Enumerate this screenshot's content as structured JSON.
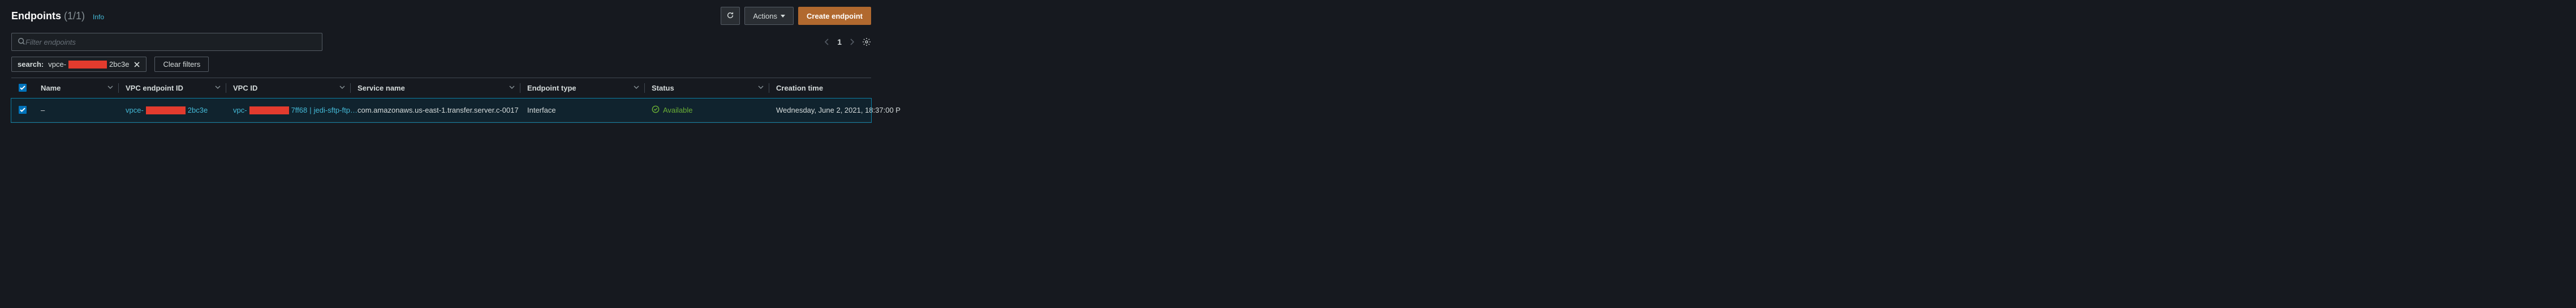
{
  "header": {
    "title": "Endpoints",
    "count": "(1/1)",
    "info": "Info"
  },
  "buttons": {
    "refresh": "",
    "actions": "Actions",
    "create": "Create endpoint",
    "clear_filters": "Clear filters"
  },
  "search": {
    "placeholder": "Filter endpoints"
  },
  "chip": {
    "prefix": "search:",
    "value_pre": "vpce-",
    "value_post": "2bc3e"
  },
  "pager": {
    "page": "1"
  },
  "columns": {
    "name": "Name",
    "endpoint_id": "VPC endpoint ID",
    "vpc_id": "VPC ID",
    "service": "Service name",
    "type": "Endpoint type",
    "status": "Status",
    "created": "Creation time"
  },
  "row": {
    "name": "–",
    "endpoint_pre": "vpce-",
    "endpoint_post": "2bc3e",
    "vpc_pre": "vpc-",
    "vpc_post": "7ff68",
    "vpc_sep": " | ",
    "vpc_name": "jedi-sftp-ftp…",
    "service": "com.amazonaws.us-east-1.transfer.server.c-0017",
    "type": "Interface",
    "status": "Available",
    "created": "Wednesday, June 2, 2021, 18:37:00 P"
  }
}
